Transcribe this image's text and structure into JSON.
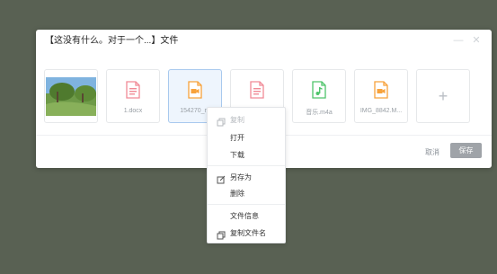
{
  "dialog": {
    "title": "【这没有什么。对于一个...】文件",
    "cancel_label": "取消",
    "save_label": "保存",
    "add_label": "+"
  },
  "files": [
    {
      "name": "",
      "type": "image"
    },
    {
      "name": "1.docx",
      "type": "document"
    },
    {
      "name": "154270_ra",
      "type": "video"
    },
    {
      "name": "",
      "type": "document"
    },
    {
      "name": "音乐.m4a",
      "type": "audio"
    },
    {
      "name": "IMG_8842.M...",
      "type": "video"
    }
  ],
  "context_menu": {
    "items": [
      {
        "label": "复制",
        "icon": "copy-icon",
        "disabled": true
      },
      {
        "label": "打开",
        "icon": "",
        "disabled": false
      },
      {
        "label": "下载",
        "icon": "",
        "disabled": false
      },
      {
        "label": "另存为",
        "icon": "save-as-icon",
        "disabled": false
      },
      {
        "label": "删除",
        "icon": "",
        "disabled": false
      },
      {
        "label": "文件信息",
        "icon": "",
        "disabled": false
      },
      {
        "label": "复制文件名",
        "icon": "copy-icon",
        "disabled": false
      }
    ]
  },
  "colors": {
    "backdrop": "#596153",
    "document_icon": "#f08a96",
    "video_icon": "#f7a23b",
    "audio_icon": "#4fc46b",
    "selected_border": "#a8c9ee"
  }
}
